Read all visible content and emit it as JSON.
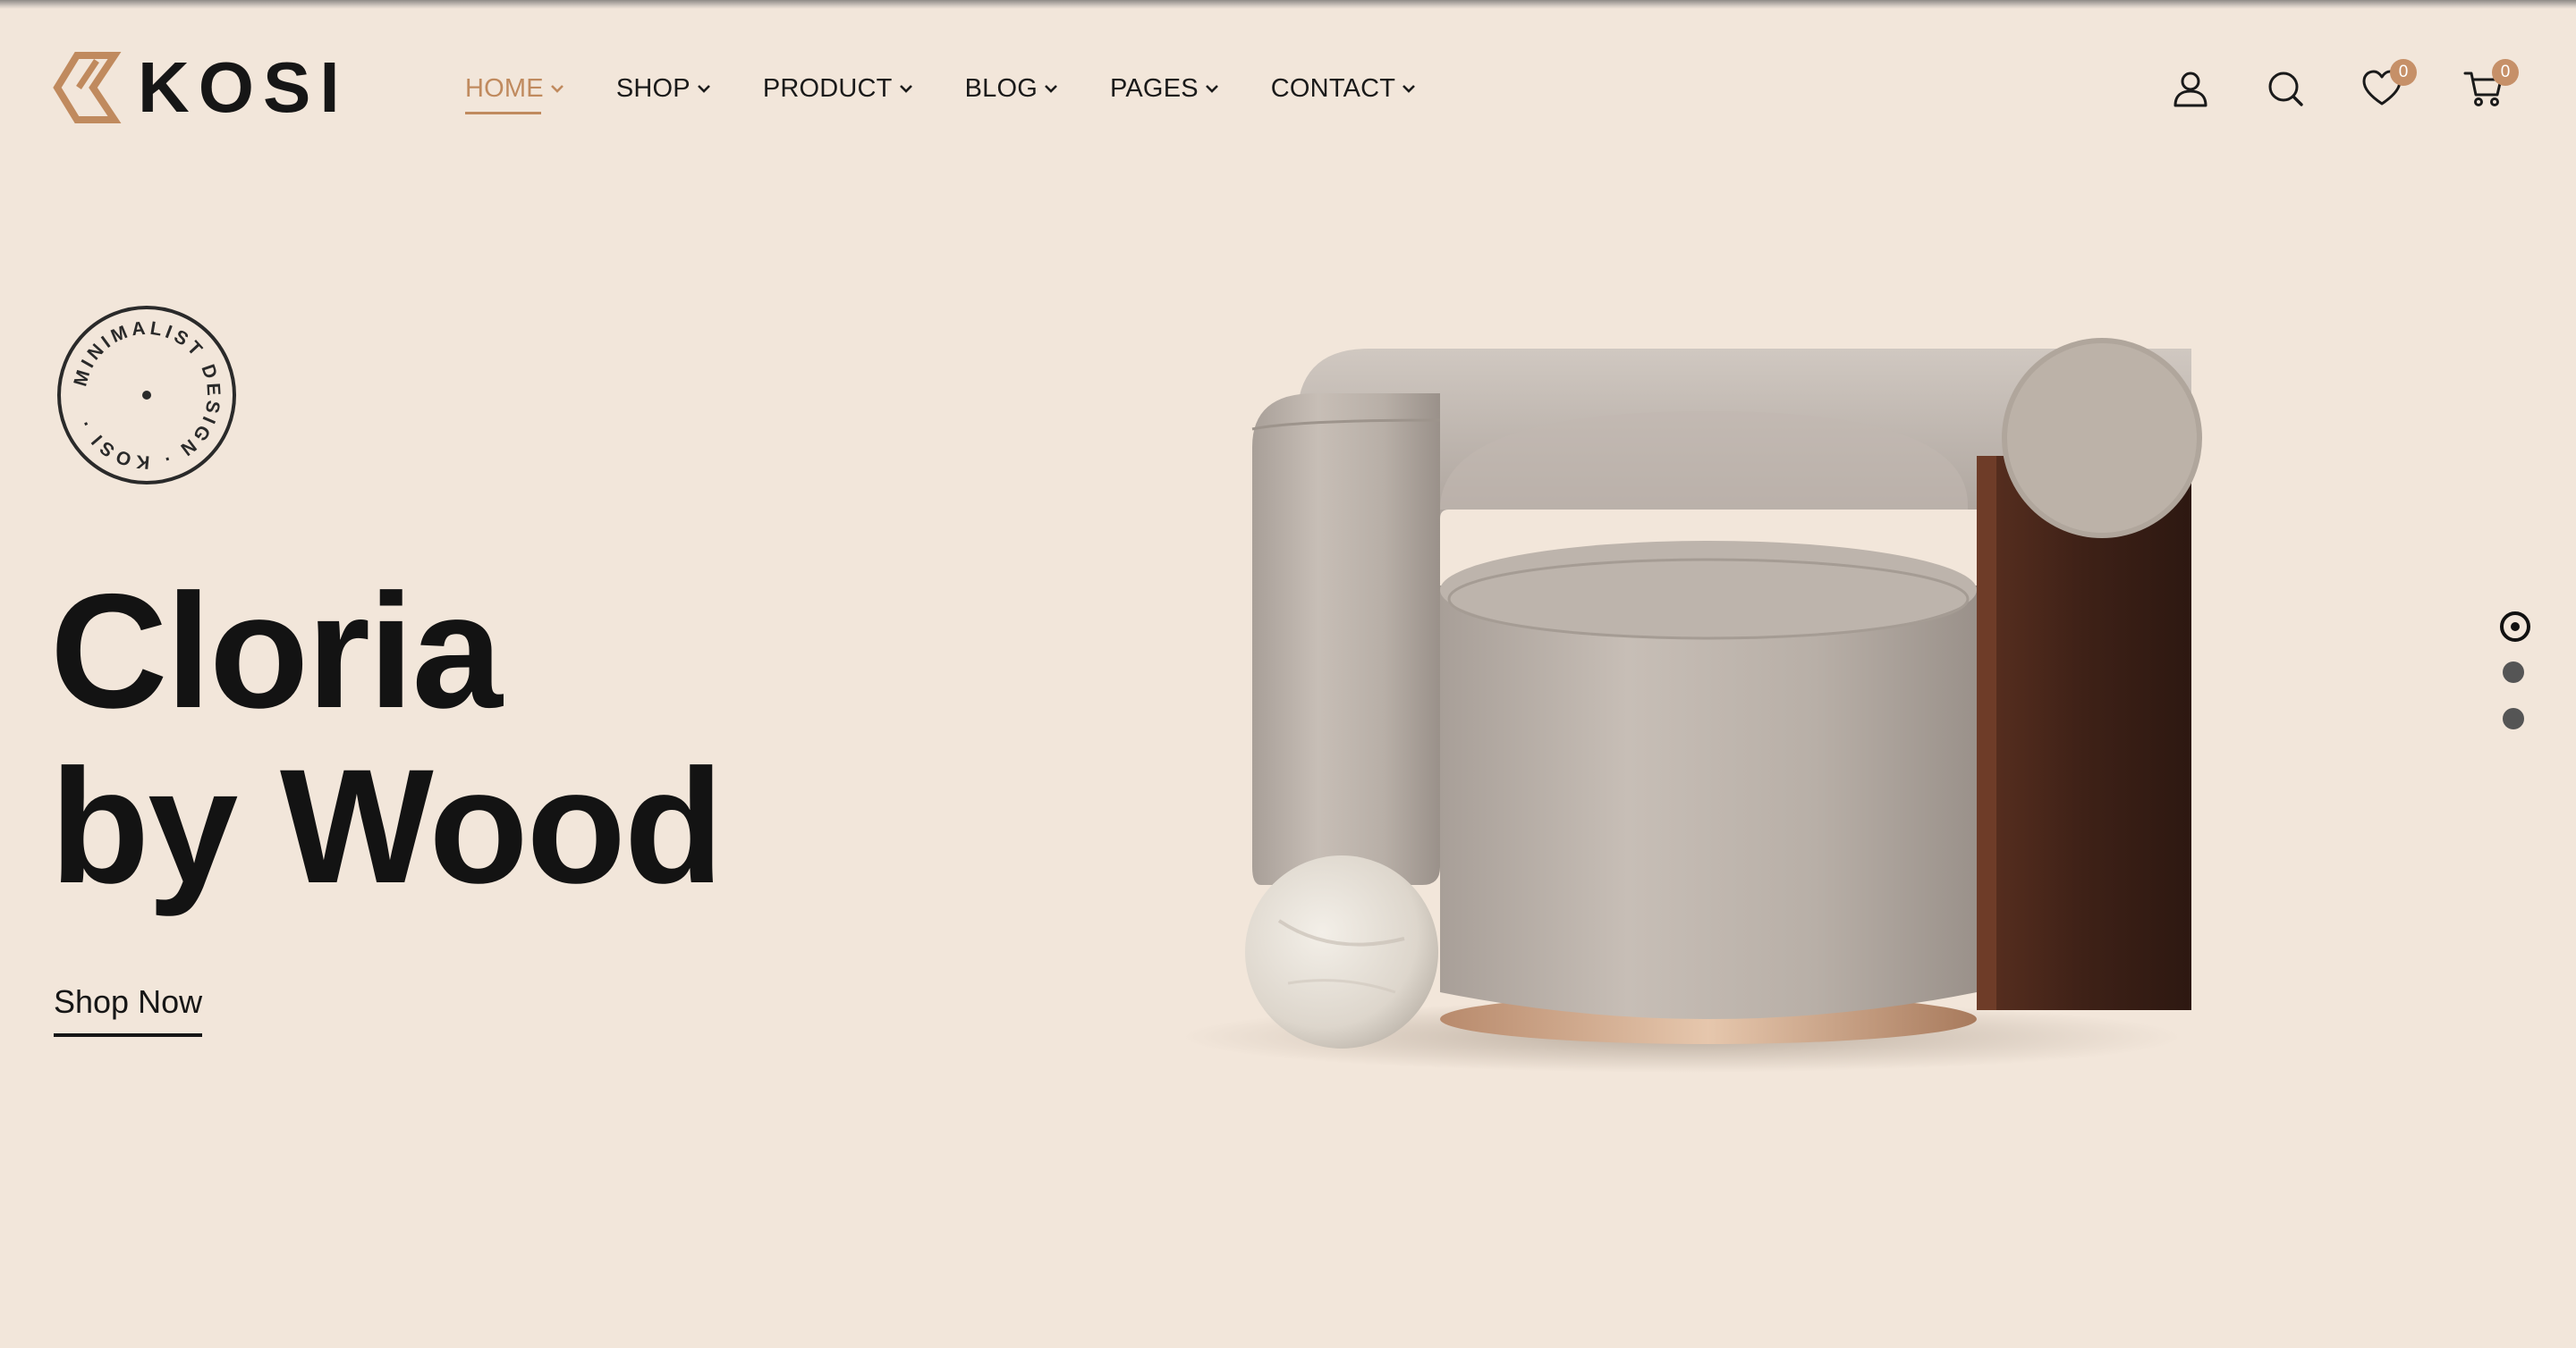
{
  "brand": {
    "name": "KOSI",
    "accent_color": "#c08a5e",
    "background_color": "#f2e6da"
  },
  "nav": {
    "items": [
      {
        "label": "HOME",
        "active": true
      },
      {
        "label": "SHOP",
        "active": false
      },
      {
        "label": "PRODUCT",
        "active": false
      },
      {
        "label": "BLOG",
        "active": false
      },
      {
        "label": "PAGES",
        "active": false
      },
      {
        "label": "CONTACT",
        "active": false
      }
    ]
  },
  "header_icons": {
    "account": "user-icon",
    "search": "search-icon",
    "wishlist": {
      "icon": "heart-icon",
      "count": "0"
    },
    "cart": {
      "icon": "cart-icon",
      "count": "0"
    }
  },
  "stamp": {
    "text": "MINIMALIST DESIGN · KOSI ·"
  },
  "hero": {
    "title_line1": "Cloria",
    "title_line2": "by Wood",
    "cta_label": "Shop Now"
  },
  "slider": {
    "total": 3,
    "active_index": 0
  }
}
